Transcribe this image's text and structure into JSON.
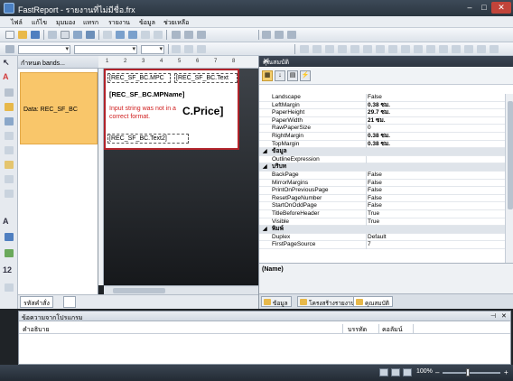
{
  "window": {
    "title": "FastReport - รายงานที่ไม่มีชื่อ.frx",
    "min": "–",
    "max": "□",
    "close": "✕"
  },
  "menu": [
    "ไฟล์",
    "แก้ไข",
    "มุมมอง",
    "แทรก",
    "รายงาน",
    "ข้อมูล",
    "ช่วยเหลือ"
  ],
  "bands_panel": {
    "header": "กำหนด bands...",
    "band_label": "Data: REC_SF_BC"
  },
  "ruler": [
    "1",
    "2",
    "3",
    "4",
    "5",
    "6",
    "7",
    "8"
  ],
  "design": {
    "obj1": "[REC_SF_BC.MPC",
    "obj2": "[REC_SF_BC.Text",
    "obj3": "[REC_SF_BC.MPName]",
    "error": "Input string was not in a correct format.",
    "price": "C.Price]",
    "obj5": "[REC_SF_BC.Text2]"
  },
  "left_tabs": {
    "tab1": "รหัสคำสั่ง"
  },
  "properties": {
    "header": "คุณสมบัติ",
    "rows": [
      {
        "type": "prop",
        "name": "Landscape",
        "value": "False"
      },
      {
        "type": "prop",
        "name": "LeftMargin",
        "value": "0.38 ซม.",
        "bold": true
      },
      {
        "type": "prop",
        "name": "PaperHeight",
        "value": "29.7 ซม.",
        "bold": true
      },
      {
        "type": "prop",
        "name": "PaperWidth",
        "value": "21 ซม.",
        "bold": true
      },
      {
        "type": "prop",
        "name": "RawPaperSize",
        "value": "0"
      },
      {
        "type": "prop",
        "name": "RightMargin",
        "value": "0.38 ซม.",
        "bold": true
      },
      {
        "type": "prop",
        "name": "TopMargin",
        "value": "0.38 ซม.",
        "bold": true
      },
      {
        "type": "cat",
        "name": "ข้อมูล"
      },
      {
        "type": "prop",
        "name": "OutlineExpression",
        "value": ""
      },
      {
        "type": "cat",
        "name": "บริบท"
      },
      {
        "type": "prop",
        "name": "BackPage",
        "value": "False"
      },
      {
        "type": "prop",
        "name": "MirrorMargins",
        "value": "False"
      },
      {
        "type": "prop",
        "name": "PrintOnPreviousPage",
        "value": "False"
      },
      {
        "type": "prop",
        "name": "ResetPageNumber",
        "value": "False"
      },
      {
        "type": "prop",
        "name": "StartOnOddPage",
        "value": "False"
      },
      {
        "type": "prop",
        "name": "TitleBeforeHeader",
        "value": "True"
      },
      {
        "type": "prop",
        "name": "Visible",
        "value": "True"
      },
      {
        "type": "cat",
        "name": "พิมพ์"
      },
      {
        "type": "prop",
        "name": "Duplex",
        "value": "Default"
      },
      {
        "type": "prop",
        "name": "FirstPageSource",
        "value": "7"
      }
    ],
    "description": "(Name)",
    "tabs": [
      "ข้อมูล",
      "โครงสร้างรายงาน",
      "คุณสมบัติ"
    ]
  },
  "messages": {
    "header": "ข้อความจากโปรแกรม",
    "col_desc": "คำอธิบาย",
    "col_line": "บรรทัด",
    "col_column": "คอลัมน์"
  },
  "status": {
    "zoom": "100%",
    "minus": "–",
    "plus": "+"
  },
  "colors": {
    "band": "#f9c66a",
    "page_border": "#b0232a",
    "error_text": "#d02020",
    "status_bar": "#2a3540"
  }
}
